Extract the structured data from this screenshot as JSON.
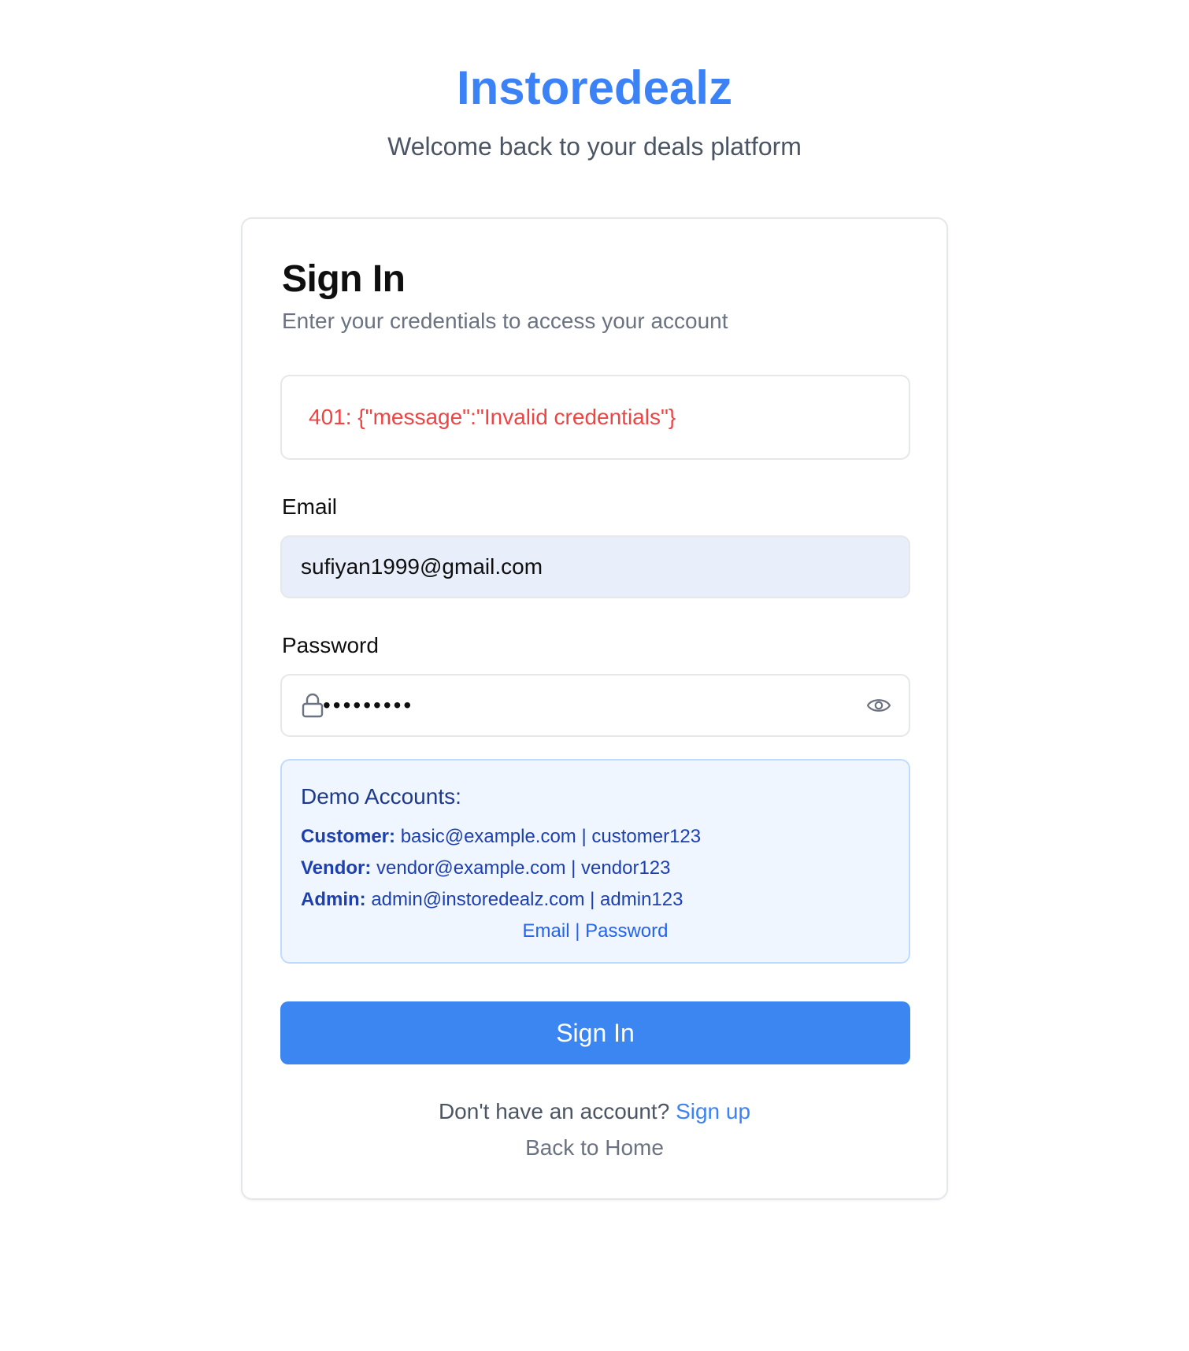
{
  "header": {
    "brand": "Instoredealz",
    "tagline": "Welcome back to your deals platform"
  },
  "card": {
    "title": "Sign In",
    "subtitle": "Enter your credentials to access your account"
  },
  "error": {
    "message": "401: {\"message\":\"Invalid credentials\"}"
  },
  "form": {
    "email_label": "Email",
    "email_value": "sufiyan1999@gmail.com",
    "password_label": "Password",
    "password_masked": "•••••••••"
  },
  "demo": {
    "title": "Demo Accounts:",
    "accounts": [
      {
        "role": "Customer:",
        "credentials": "basic@example.com | customer123"
      },
      {
        "role": "Vendor:",
        "credentials": "vendor@example.com | vendor123"
      },
      {
        "role": "Admin:",
        "credentials": "admin@instoredealz.com | admin123"
      }
    ],
    "hint": "Email | Password"
  },
  "actions": {
    "signin_label": "Sign In",
    "signup_prompt": "Don't have an account?",
    "signup_link": "Sign up",
    "home_link": "Back to Home"
  },
  "colors": {
    "brand": "#3b82f6",
    "error": "#ef4444",
    "demo_bg": "#eff6ff",
    "email_bg": "#e8effb"
  },
  "icons": {
    "lock": "lock-icon",
    "eye": "eye-icon"
  }
}
